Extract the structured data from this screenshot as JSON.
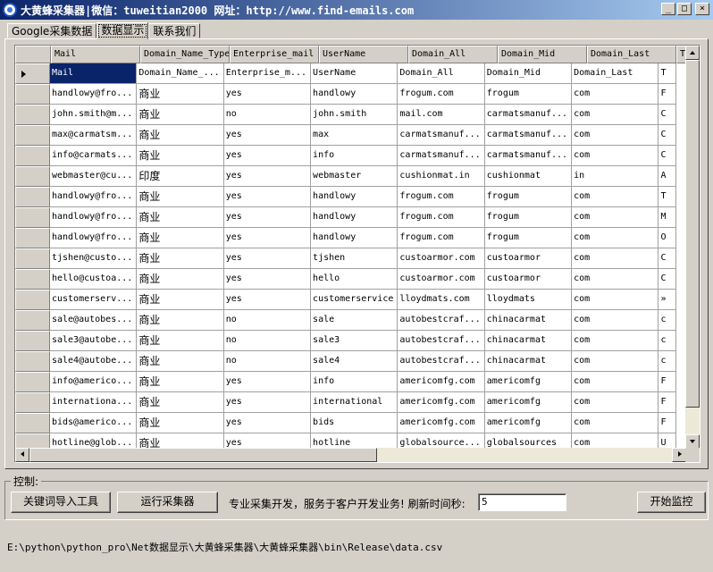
{
  "window": {
    "title": "大黄蜂采集器|微信：tuweitian2000 网址：http://www.find-emails.com",
    "min_label": "_",
    "max_label": "□",
    "close_label": "×"
  },
  "tabs": [
    {
      "label": "Google采集数据",
      "active": false
    },
    {
      "label": "数据显示",
      "active": true
    },
    {
      "label": "联系我们",
      "active": false
    }
  ],
  "grid": {
    "columns": [
      "Mail",
      "Domain_Name_Type",
      "Enterprise_mail",
      "UserName",
      "Domain_All",
      "Domain_Mid",
      "Domain_Last",
      "T"
    ],
    "rows": [
      [
        "Mail",
        "Domain_Name_...",
        "Enterprise_m...",
        "UserName",
        "Domain_All",
        "Domain_Mid",
        "Domain_Last",
        "T"
      ],
      [
        "handlowy@fro...",
        "商业",
        "yes",
        "handlowy",
        "frogum.com",
        "frogum",
        "com",
        "F"
      ],
      [
        "john.smith@m...",
        "商业",
        "no",
        "john.smith",
        "mail.com",
        "carmatsmanuf...",
        "com",
        "C"
      ],
      [
        "max@carmatsm...",
        "商业",
        "yes",
        "max",
        "carmatsmanuf...",
        "carmatsmanuf...",
        "com",
        "C"
      ],
      [
        "info@carmats...",
        "商业",
        "yes",
        "info",
        "carmatsmanuf...",
        "carmatsmanuf...",
        "com",
        "C"
      ],
      [
        "webmaster@cu...",
        "印度",
        "yes",
        "webmaster",
        "cushionmat.in",
        "cushionmat",
        "in",
        "A"
      ],
      [
        "handlowy@fro...",
        "商业",
        "yes",
        "handlowy",
        "frogum.com",
        "frogum",
        "com",
        "T"
      ],
      [
        "handlowy@fro...",
        "商业",
        "yes",
        "handlowy",
        "frogum.com",
        "frogum",
        "com",
        "M"
      ],
      [
        "handlowy@fro...",
        "商业",
        "yes",
        "handlowy",
        "frogum.com",
        "frogum",
        "com",
        "O"
      ],
      [
        "tjshen@custo...",
        "商业",
        "yes",
        "tjshen",
        "custoarmor.com",
        "custoarmor",
        "com",
        "C"
      ],
      [
        "hello@custoa...",
        "商业",
        "yes",
        "hello",
        "custoarmor.com",
        "custoarmor",
        "com",
        "C"
      ],
      [
        "customerserv...",
        "商业",
        "yes",
        "customerservice",
        "lloydmats.com",
        "lloydmats",
        "com",
        "»"
      ],
      [
        "sale@autobes...",
        "商业",
        "no",
        "sale",
        "autobestcraf...",
        "chinacarmat",
        "com",
        "c"
      ],
      [
        "sale3@autobe...",
        "商业",
        "no",
        "sale3",
        "autobestcraf...",
        "chinacarmat",
        "com",
        "c"
      ],
      [
        "sale4@autobe...",
        "商业",
        "no",
        "sale4",
        "autobestcraf...",
        "chinacarmat",
        "com",
        "c"
      ],
      [
        "info@americo...",
        "商业",
        "yes",
        "info",
        "americomfg.com",
        "americomfg",
        "com",
        "F"
      ],
      [
        "internationa...",
        "商业",
        "yes",
        "international",
        "americomfg.com",
        "americomfg",
        "com",
        "F"
      ],
      [
        "bids@americo...",
        "商业",
        "yes",
        "bids",
        "americomfg.com",
        "americomfg",
        "com",
        "F"
      ],
      [
        "hotline@glob...",
        "商业",
        "yes",
        "hotline",
        "globalsource...",
        "globalsources",
        "com",
        "U"
      ]
    ]
  },
  "controls": {
    "group_label": "控制:",
    "import_keywords_button": "关键词导入工具",
    "run_collector_button": "运行采集器",
    "slogan": "专业采集开发，服务于客户开发业务! 刷新时间秒:",
    "refresh_seconds": "5",
    "start_monitor_button": "开始监控"
  },
  "status_path": "E:\\python\\python_pro\\Net数据显示\\大黄蜂采集器\\大黄蜂采集器\\bin\\Release\\data.csv"
}
